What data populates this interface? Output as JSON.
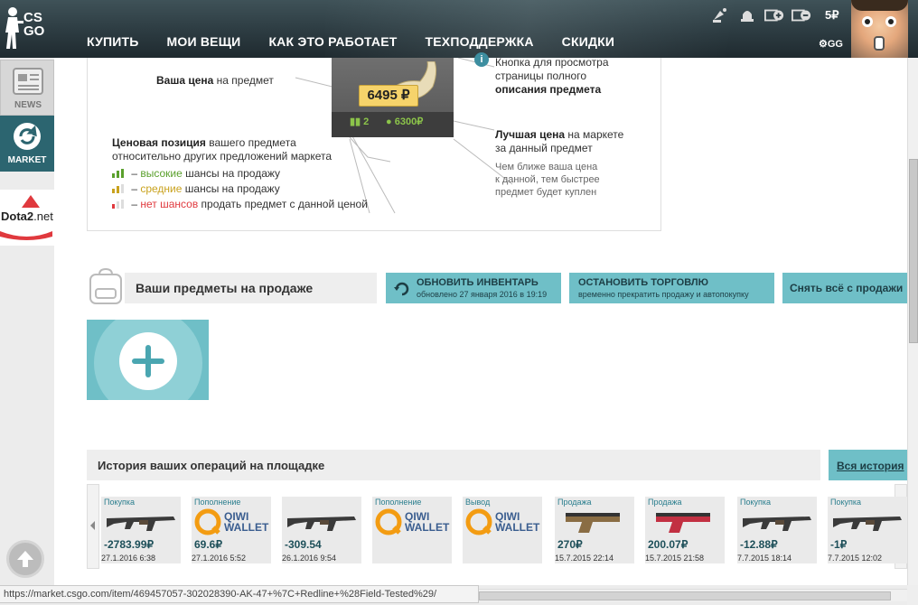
{
  "header": {
    "logo_text": "CS GO",
    "nav": [
      "КУПИТЬ",
      "МОИ ВЕЩИ",
      "КАК ЭТО РАБОТАЕТ",
      "ТЕХПОДДЕРЖКА",
      "СКИДКИ"
    ],
    "balance": "5₽",
    "gg_label": "GG",
    "icons": [
      "satellite-icon",
      "bell-icon",
      "add-funds-icon",
      "withdraw-icon"
    ]
  },
  "sidebar": {
    "news_label": "NEWS",
    "market_label": "MARKET",
    "dota_label_a": "Dota2",
    "dota_label_b": ".net"
  },
  "info": {
    "your_price_bold": "Ваша цена",
    "your_price_rest": " на предмет",
    "card_price": "6495 ₽",
    "card_count": "2",
    "card_best": "6300₽",
    "info_button": "i",
    "position_bold": "Ценовая позиция",
    "position_rest": " вашего предмета",
    "position_line2": "относительно других предложений маркета",
    "legend": [
      {
        "dash": " – ",
        "word": "высокие",
        "rest": " шансы на продажу",
        "tone": "hi"
      },
      {
        "dash": " – ",
        "word": "средние",
        "rest": " шансы на продажу",
        "tone": "mid"
      },
      {
        "dash": " – ",
        "word": "нет шансов",
        "rest": " продать предмет с данной ценой",
        "tone": "lo"
      }
    ],
    "button_line1": "Кнопка для просмотра",
    "button_line2": "страницы полного",
    "button_line3": "описания предмета",
    "best_bold": "Лучшая цена",
    "best_rest": " на маркете",
    "best_line2": "за данный предмет",
    "hint_line1": "Чем ближе ваша цена",
    "hint_line2": "к данной, тем быстрее",
    "hint_line3": "предмет будет куплен"
  },
  "sale": {
    "title": "Ваши предметы на продаже",
    "refresh_title": "ОБНОВИТЬ ИНВЕНТАРЬ",
    "refresh_sub": "обновлено 27 января 2016 в 19:19",
    "stop_title": "ОСТАНОВИТЬ ТОРГОВЛЮ",
    "stop_sub": "временно прекратить продажу и автопокупку",
    "remove_all": "Снять всё с продажи"
  },
  "history": {
    "title": "История ваших операций на площадке",
    "all_link": "Вся история",
    "items": [
      {
        "kind": "Покупка",
        "amount": "-2783.99₽",
        "date": "27.1.2016 6:38",
        "pic": "rifle"
      },
      {
        "kind": "Пополнение",
        "amount": "69.6₽",
        "date": "27.1.2016 5:52",
        "pic": "qiwi"
      },
      {
        "kind": "",
        "amount": "-309.54",
        "date": "26.1.2016 9:54",
        "pic": "rifle"
      },
      {
        "kind": "Пополнение",
        "amount": "",
        "date": "",
        "pic": "qiwi"
      },
      {
        "kind": "Вывод",
        "amount": "",
        "date": "",
        "pic": "qiwi"
      },
      {
        "kind": "Продажа",
        "amount": "270₽",
        "date": "15.7.2015 22:14",
        "pic": "pistol"
      },
      {
        "kind": "Продажа",
        "amount": "200.07₽",
        "date": "15.7.2015 21:58",
        "pic": "pistol2"
      },
      {
        "kind": "Покупка",
        "amount": "-12.88₽",
        "date": "7.7.2015 18:14",
        "pic": "rifle"
      },
      {
        "kind": "Покупка",
        "amount": "-1₽",
        "date": "7.7.2015 12:02",
        "pic": "rifle"
      }
    ],
    "qiwi_line1": "QIWI",
    "qiwi_line2": "WALLET"
  },
  "status_url": "https://market.csgo.com/item/469457057-302028390-AK-47+%7C+Redline+%28Field-Tested%29/",
  "colors": {
    "accent": "#6fbfc7",
    "header": "#2c3b41",
    "high": "#5aa02c",
    "mid": "#c9a21e",
    "low": "#e0393e"
  }
}
